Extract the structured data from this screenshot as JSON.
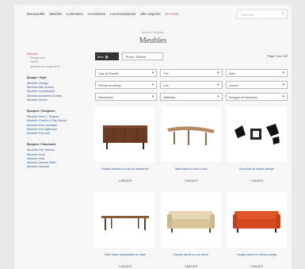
{
  "nav": {
    "items": [
      "Nouveautés",
      "Meubles",
      "Luminaires",
      "Accessoires",
      "Lux Exceptionnel",
      "Idée Inspirant"
    ],
    "highlight": "En Vente",
    "accent_color": "#d14aa0"
  },
  "search": {
    "placeholder": "Chercher",
    "icon": "search-icon"
  },
  "breadcrumb": "Accueil / Meubles",
  "page_title": "Meubles",
  "sidebar": {
    "active_category": "Meubles",
    "sub_items": [
      "Rangement",
      "Tables",
      "Meubles de rangement"
    ],
    "groups": [
      {
        "heading": "Époque / Style",
        "links": [
          "Meubles Vintage",
          "Meubles Mid-Century",
          "Meubles Scandinaves",
          "Meubles industriels & métal",
          "Meubles Danois"
        ]
      },
      {
        "heading": "Époques / Designers",
        "links": [
          "Meubles Hans J. Wegner",
          "Meubles Charles & Ray Eames",
          "Meubles Arne Jacobsen",
          "Meubles Poul Kjærholm",
          "Meubles Finn Juhl"
        ]
      },
      {
        "heading": "Époques / Fabricants",
        "links": [
          "Meubles Fritz Hansen",
          "Meubles Knoll",
          "Meubles Vitra",
          "Meubles Herman Miller",
          "Meubles Cassina"
        ]
      }
    ]
  },
  "toolbar": {
    "view_label": "Mos. ▦",
    "sort_label": "Tri par : Récent",
    "page_count": "Page 1 sur 120"
  },
  "filters": [
    "Type de Produit",
    "Prix",
    "Style",
    "Période du design",
    "Lieu",
    "Couleur",
    "Dimensions",
    "Matériaux",
    "Designer et Fabricants"
  ],
  "products": [
    {
      "name": "Enfilade danoise en bois de palissandre",
      "price": "4 800,00 €"
    },
    {
      "name": "Table basse en bois d'orme",
      "price": "2 500,00 €"
    },
    {
      "name": "Ensemble de lampes vintage",
      "price": "1 500,00 €"
    },
    {
      "name": "Table basse rectangulaire en noyer",
      "price": "1 600,00 €"
    },
    {
      "name": "Canapé danois en cuir crème",
      "price": "3 800,00 €"
    },
    {
      "name": "Canapé danois en velours orange",
      "price": "3 600,00 €"
    }
  ]
}
